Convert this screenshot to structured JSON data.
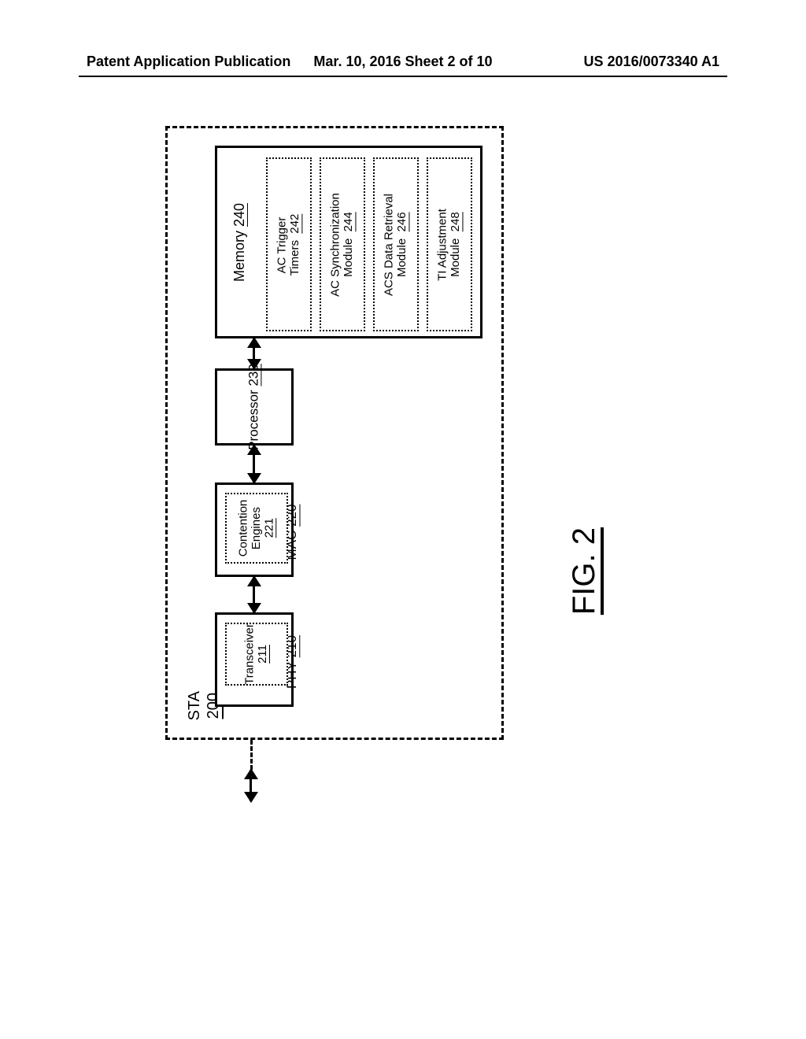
{
  "header": {
    "left": "Patent Application Publication",
    "center": "Mar. 10, 2016  Sheet 2 of 10",
    "right": "US 2016/0073340 A1"
  },
  "figure_label": "FIG. 2",
  "sta": {
    "name": "STA",
    "ref": "200"
  },
  "phy": {
    "name": "PHY",
    "ref": "210"
  },
  "transceiver": {
    "name": "Transceiver",
    "ref": "211"
  },
  "mac": {
    "name": "MAC",
    "ref": "220"
  },
  "contention": {
    "name_l1": "Contention",
    "name_l2": "Engines",
    "ref": "221"
  },
  "processor": {
    "name": "Processor",
    "ref": "230"
  },
  "memory": {
    "name": "Memory",
    "ref": "240"
  },
  "timers": {
    "name_l1": "AC Trigger",
    "name_l2": "Timers",
    "ref": "242"
  },
  "sync": {
    "name_l1": "AC Synchronization",
    "name_l2": "Module",
    "ref": "244"
  },
  "retr": {
    "name_l1": "ACS Data Retrieval",
    "name_l2": "Module",
    "ref": "246"
  },
  "tiadj": {
    "name_l1": "TI Adjustment",
    "name_l2": "Module",
    "ref": "248"
  }
}
